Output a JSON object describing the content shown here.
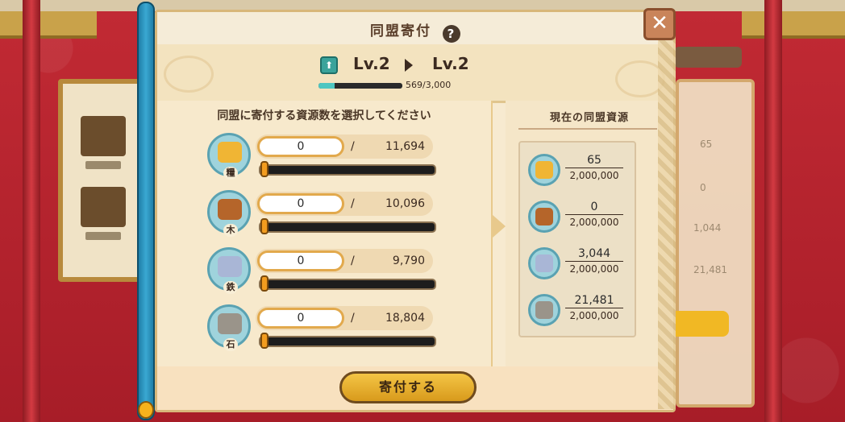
{
  "dialog": {
    "title": "同盟寄付",
    "help_icon": "?",
    "close_icon": "✕"
  },
  "level": {
    "current": "Lv.2",
    "next": "Lv.2",
    "exp_text": "569/3,000",
    "exp_fraction": 0.19
  },
  "left": {
    "section_title": "同盟に寄付する資源数を選択してください",
    "resources": [
      {
        "tag": "糧",
        "icon": "grain-icon",
        "value": "0",
        "slash": "/",
        "max": "11,694",
        "color": "#f0b534"
      },
      {
        "tag": "木",
        "icon": "wood-icon",
        "value": "0",
        "slash": "/",
        "max": "10,096",
        "color": "#b5652a"
      },
      {
        "tag": "鉄",
        "icon": "iron-icon",
        "value": "0",
        "slash": "/",
        "max": "9,790",
        "color": "#a9b6d6"
      },
      {
        "tag": "石",
        "icon": "stone-icon",
        "value": "0",
        "slash": "/",
        "max": "18,804",
        "color": "#9a948a"
      }
    ]
  },
  "right": {
    "title": "現在の同盟資源",
    "pool": [
      {
        "icon": "grain-icon",
        "value": "65",
        "capacity": "2,000,000",
        "color": "#f0b534"
      },
      {
        "icon": "wood-icon",
        "value": "0",
        "capacity": "2,000,000",
        "color": "#b5652a"
      },
      {
        "icon": "iron-icon",
        "value": "3,044",
        "capacity": "2,000,000",
        "color": "#a9b6d6"
      },
      {
        "icon": "stone-icon",
        "value": "21,481",
        "capacity": "2,000,000",
        "color": "#9a948a"
      }
    ]
  },
  "footer": {
    "donate_label": "寄付する"
  },
  "background": {
    "right_values": [
      "65",
      "0",
      "1,044",
      "21,481"
    ]
  }
}
